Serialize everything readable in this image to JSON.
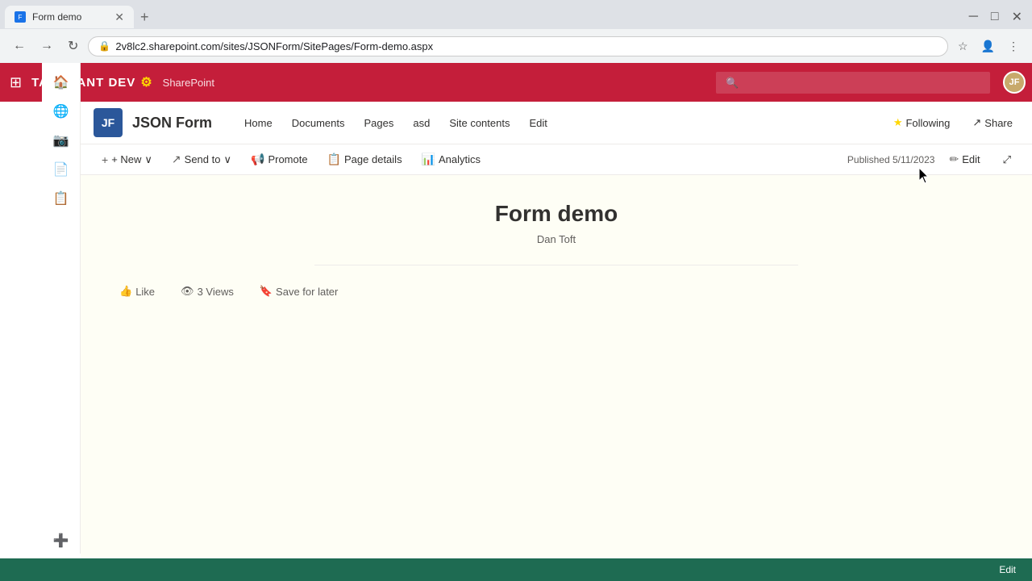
{
  "browser": {
    "tab_title": "Form demo",
    "url": "2v8lc2.sharepoint.com/sites/JSONForm/SitePages/Form-demo.aspx",
    "new_tab_label": "+",
    "back_btn": "←",
    "forward_btn": "→",
    "refresh_btn": "↻",
    "search_placeholder": "🔍"
  },
  "topbar": {
    "waffle": "⊞",
    "brand": "TANDDANT DEV",
    "gear_icon": "⚙",
    "suite_name": "SharePoint",
    "search_placeholder": "🔍",
    "avatar_initials": "JF"
  },
  "site": {
    "logo_initials": "JF",
    "title": "JSON Form",
    "nav": [
      {
        "label": "Home"
      },
      {
        "label": "Documents"
      },
      {
        "label": "Pages"
      },
      {
        "label": "asd"
      },
      {
        "label": "Site contents"
      },
      {
        "label": "Edit"
      }
    ],
    "following_label": "Following",
    "share_label": "Share"
  },
  "commandbar": {
    "new_label": "+ New",
    "send_to_label": "Send to",
    "promote_label": "Promote",
    "page_details_label": "Page details",
    "analytics_label": "Analytics",
    "published_text": "Published 5/11/2023",
    "edit_label": "Edit",
    "expand_label": "⤢"
  },
  "page": {
    "title": "Form demo",
    "author": "Dan Toft",
    "like_label": "Like",
    "views_label": "3 Views",
    "save_label": "Save for later"
  },
  "statusbar": {
    "edit_label": "Edit"
  }
}
